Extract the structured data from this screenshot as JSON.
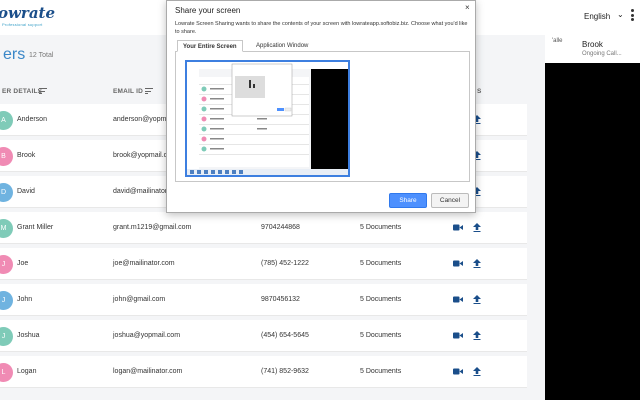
{
  "header": {
    "logo_text": "owrate",
    "logo_tagline": "Professional support",
    "language": "English"
  },
  "list": {
    "title": "ers",
    "total": "12 Total",
    "columns": {
      "details": "ER DETAILS",
      "email": "EMAIL ID",
      "extra": "S"
    }
  },
  "rows": [
    {
      "initial": "A",
      "color": "#7fcbb8",
      "name": "Anderson",
      "email": "anderson@yopmail.com",
      "phone": "",
      "docs": ""
    },
    {
      "initial": "B",
      "color": "#f08bb4",
      "name": "Brook",
      "email": "brook@yopmail.com",
      "phone": "",
      "docs": ""
    },
    {
      "initial": "D",
      "color": "#6fb3e0",
      "name": "David",
      "email": "david@mailinator.com",
      "phone": "",
      "docs": ""
    },
    {
      "initial": "M",
      "color": "#7fcbb8",
      "name": "Grant Miller",
      "email": "grant.m1219@gmail.com",
      "phone": "9704244868",
      "docs": "5 Documents"
    },
    {
      "initial": "J",
      "color": "#f08bb4",
      "name": "Joe",
      "email": "joe@mailinator.com",
      "phone": "(785) 452-1222",
      "docs": "5 Documents"
    },
    {
      "initial": "J",
      "color": "#6fb3e0",
      "name": "John",
      "email": "john@gmail.com",
      "phone": "9870456132",
      "docs": "5 Documents"
    },
    {
      "initial": "J",
      "color": "#7fcbb8",
      "name": "Joshua",
      "email": "joshua@yopmail.com",
      "phone": "(454) 654-5645",
      "docs": "5 Documents"
    },
    {
      "initial": "L",
      "color": "#f08bb4",
      "name": "Logan",
      "email": "logan@mailinator.com",
      "phone": "(741) 852-9632",
      "docs": "5 Documents"
    }
  ],
  "caller": {
    "img_alt": "'alle",
    "name": "Brook",
    "status": "Ongoing Call..."
  },
  "dialog": {
    "title": "Share your screen",
    "close": "×",
    "description": "Lowrate Screen Sharing wants to share the contents of your screen with lowrateapp.softobiz.biz. Choose what you'd like to share.",
    "tabs": [
      "Your Entire Screen",
      "Application Window"
    ],
    "share_label": "Share",
    "cancel_label": "Cancel"
  },
  "colors": {
    "accent": "#3a87c8",
    "video_icon": "#1a4e8a",
    "share_button": "#4d90fe"
  }
}
